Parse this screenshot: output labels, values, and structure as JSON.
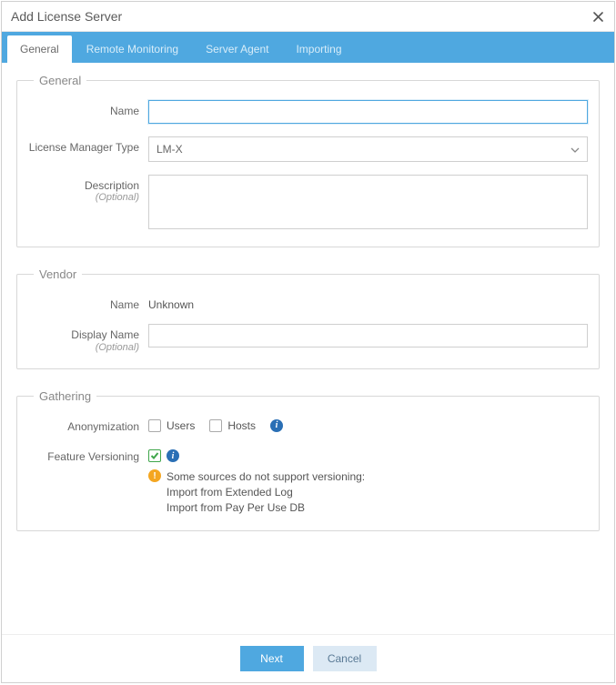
{
  "dialog": {
    "title": "Add License Server"
  },
  "tabs": {
    "items": [
      {
        "label": "General",
        "active": true
      },
      {
        "label": "Remote Monitoring",
        "active": false
      },
      {
        "label": "Server Agent",
        "active": false
      },
      {
        "label": "Importing",
        "active": false
      }
    ]
  },
  "groups": {
    "general": {
      "legend": "General",
      "name_label": "Name",
      "name_value": "",
      "lmt_label": "License Manager Type",
      "lmt_selected": "LM-X",
      "desc_label": "Description",
      "desc_optional": "(Optional)",
      "desc_value": ""
    },
    "vendor": {
      "legend": "Vendor",
      "name_label": "Name",
      "name_value": "Unknown",
      "display_label": "Display Name",
      "display_optional": "(Optional)",
      "display_value": ""
    },
    "gathering": {
      "legend": "Gathering",
      "anon_label": "Anonymization",
      "anon_users_label": "Users",
      "anon_users_checked": false,
      "anon_hosts_label": "Hosts",
      "anon_hosts_checked": false,
      "fv_label": "Feature Versioning",
      "fv_checked": true,
      "fv_warning": "Some sources do not support versioning:",
      "fv_sub1": "Import from Extended Log",
      "fv_sub2": "Import from Pay Per Use DB"
    }
  },
  "footer": {
    "next_label": "Next",
    "cancel_label": "Cancel"
  }
}
